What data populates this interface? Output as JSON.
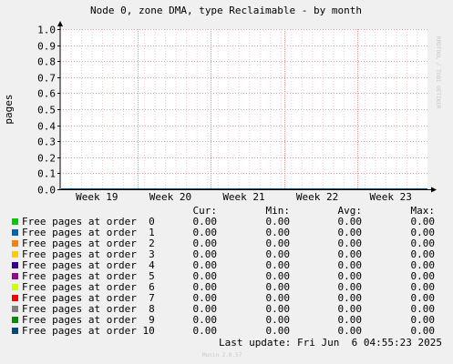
{
  "chart_data": {
    "type": "line",
    "title": "Node 0, zone DMA, type Reclaimable - by month",
    "ylabel": "pages",
    "xlabel": "",
    "ylim": [
      0.0,
      1.0
    ],
    "y_ticks": [
      "0.0",
      "0.1",
      "0.2",
      "0.3",
      "0.4",
      "0.5",
      "0.6",
      "0.7",
      "0.8",
      "0.9",
      "1.0"
    ],
    "x_ticks": [
      "Week 19",
      "Week 20",
      "Week 21",
      "Week 22",
      "Week 23"
    ],
    "grid": true,
    "series": [
      {
        "name": "Free pages at order  0",
        "color": "#00cc00",
        "cur": "0.00",
        "min": "0.00",
        "avg": "0.00",
        "max": "0.00"
      },
      {
        "name": "Free pages at order  1",
        "color": "#0066b3",
        "cur": "0.00",
        "min": "0.00",
        "avg": "0.00",
        "max": "0.00"
      },
      {
        "name": "Free pages at order  2",
        "color": "#ff8000",
        "cur": "0.00",
        "min": "0.00",
        "avg": "0.00",
        "max": "0.00"
      },
      {
        "name": "Free pages at order  3",
        "color": "#ffcc00",
        "cur": "0.00",
        "min": "0.00",
        "avg": "0.00",
        "max": "0.00"
      },
      {
        "name": "Free pages at order  4",
        "color": "#330099",
        "cur": "0.00",
        "min": "0.00",
        "avg": "0.00",
        "max": "0.00"
      },
      {
        "name": "Free pages at order  5",
        "color": "#990099",
        "cur": "0.00",
        "min": "0.00",
        "avg": "0.00",
        "max": "0.00"
      },
      {
        "name": "Free pages at order  6",
        "color": "#ccff00",
        "cur": "0.00",
        "min": "0.00",
        "avg": "0.00",
        "max": "0.00"
      },
      {
        "name": "Free pages at order  7",
        "color": "#ff0000",
        "cur": "0.00",
        "min": "0.00",
        "avg": "0.00",
        "max": "0.00"
      },
      {
        "name": "Free pages at order  8",
        "color": "#808080",
        "cur": "0.00",
        "min": "0.00",
        "avg": "0.00",
        "max": "0.00"
      },
      {
        "name": "Free pages at order  9",
        "color": "#008f00",
        "cur": "0.00",
        "min": "0.00",
        "avg": "0.00",
        "max": "0.00"
      },
      {
        "name": "Free pages at order 10",
        "color": "#00487d",
        "cur": "0.00",
        "min": "0.00",
        "avg": "0.00",
        "max": "0.00"
      }
    ]
  },
  "legend_headers": {
    "cur": "Cur:",
    "min": "Min:",
    "avg": "Avg:",
    "max": "Max:"
  },
  "last_update": "Last update: Fri Jun  6 04:55:23 2025",
  "footer": "Munin 2.0.57",
  "watermark": "RRDTOOL / TOBI OETIKER"
}
